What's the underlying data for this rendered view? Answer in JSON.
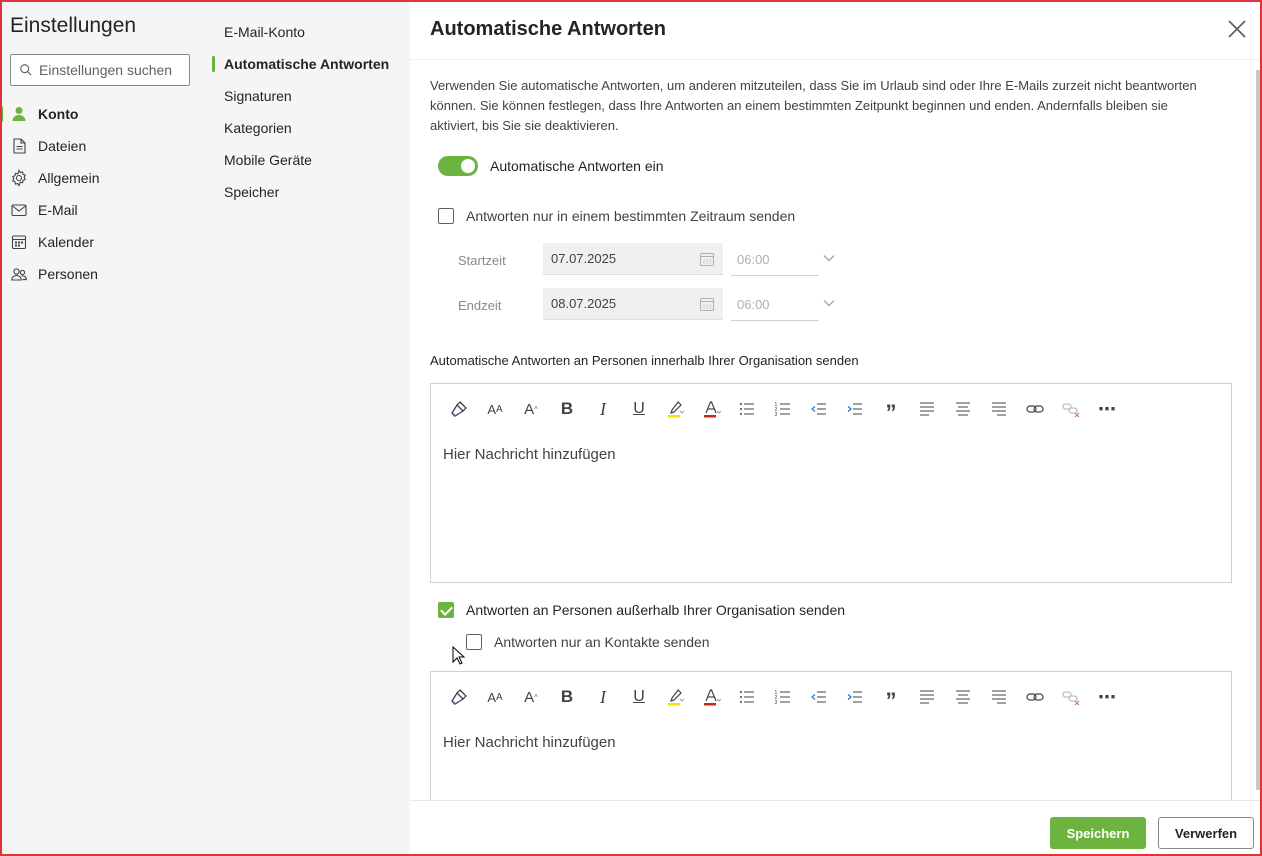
{
  "sidebar": {
    "title": "Einstellungen",
    "search_placeholder": "Einstellungen suchen",
    "items": [
      {
        "label": "Konto",
        "icon": "person-icon",
        "active": true
      },
      {
        "label": "Dateien",
        "icon": "document-icon"
      },
      {
        "label": "Allgemein",
        "icon": "gear-icon"
      },
      {
        "label": "E-Mail",
        "icon": "mail-icon"
      },
      {
        "label": "Kalender",
        "icon": "calendar-icon"
      },
      {
        "label": "Personen",
        "icon": "people-icon"
      }
    ]
  },
  "subnav": {
    "items": [
      {
        "label": "E-Mail-Konto"
      },
      {
        "label": "Automatische Antworten",
        "active": true
      },
      {
        "label": "Signaturen"
      },
      {
        "label": "Kategorien"
      },
      {
        "label": "Mobile Geräte"
      },
      {
        "label": "Speicher"
      }
    ]
  },
  "panel": {
    "title": "Automatische Antworten",
    "description": "Verwenden Sie automatische Antworten, um anderen mitzuteilen, dass Sie im Urlaub sind oder Ihre E-Mails zurzeit nicht beantworten können. Sie können festlegen, dass Ihre Antworten an einem bestimmten Zeitpunkt beginnen und enden. Andernfalls bleiben sie aktiviert, bis Sie sie deaktivieren.",
    "toggle_label": "Automatische Antworten ein",
    "toggle_on": true,
    "timerange_label": "Antworten nur in einem bestimmten Zeitraum senden",
    "timerange_checked": false,
    "start": {
      "label": "Startzeit",
      "date": "07.07.2025",
      "time": "06:00"
    },
    "end": {
      "label": "Endzeit",
      "date": "08.07.2025",
      "time": "06:00"
    },
    "internal_label": "Automatische Antworten an Personen innerhalb Ihrer Organisation senden",
    "editor_placeholder": "Hier Nachricht hinzufügen",
    "external_label": "Antworten an Personen außerhalb Ihrer Organisation senden",
    "external_checked": true,
    "contacts_only_label": "Antworten nur an Kontakte senden",
    "contacts_only_checked": false
  },
  "toolbar": {
    "items": [
      "format-painter-icon",
      "font-size-icon",
      "grow-font-icon",
      "bold-icon",
      "italic-icon",
      "underline-icon",
      "highlight-icon",
      "font-color-icon",
      "bullets-icon",
      "numbering-icon",
      "decrease-indent-icon",
      "increase-indent-icon",
      "quote-icon",
      "align-left-icon",
      "align-center-icon",
      "align-right-icon",
      "link-icon",
      "unlink-icon",
      "more-icon"
    ],
    "bold": "B",
    "italic": "I",
    "underline": "U",
    "quote": "”",
    "more": "⋯"
  },
  "footer": {
    "save_label": "Speichern",
    "discard_label": "Verwerfen"
  },
  "colors": {
    "accent": "#6cb33f",
    "frame": "#e0343c"
  }
}
